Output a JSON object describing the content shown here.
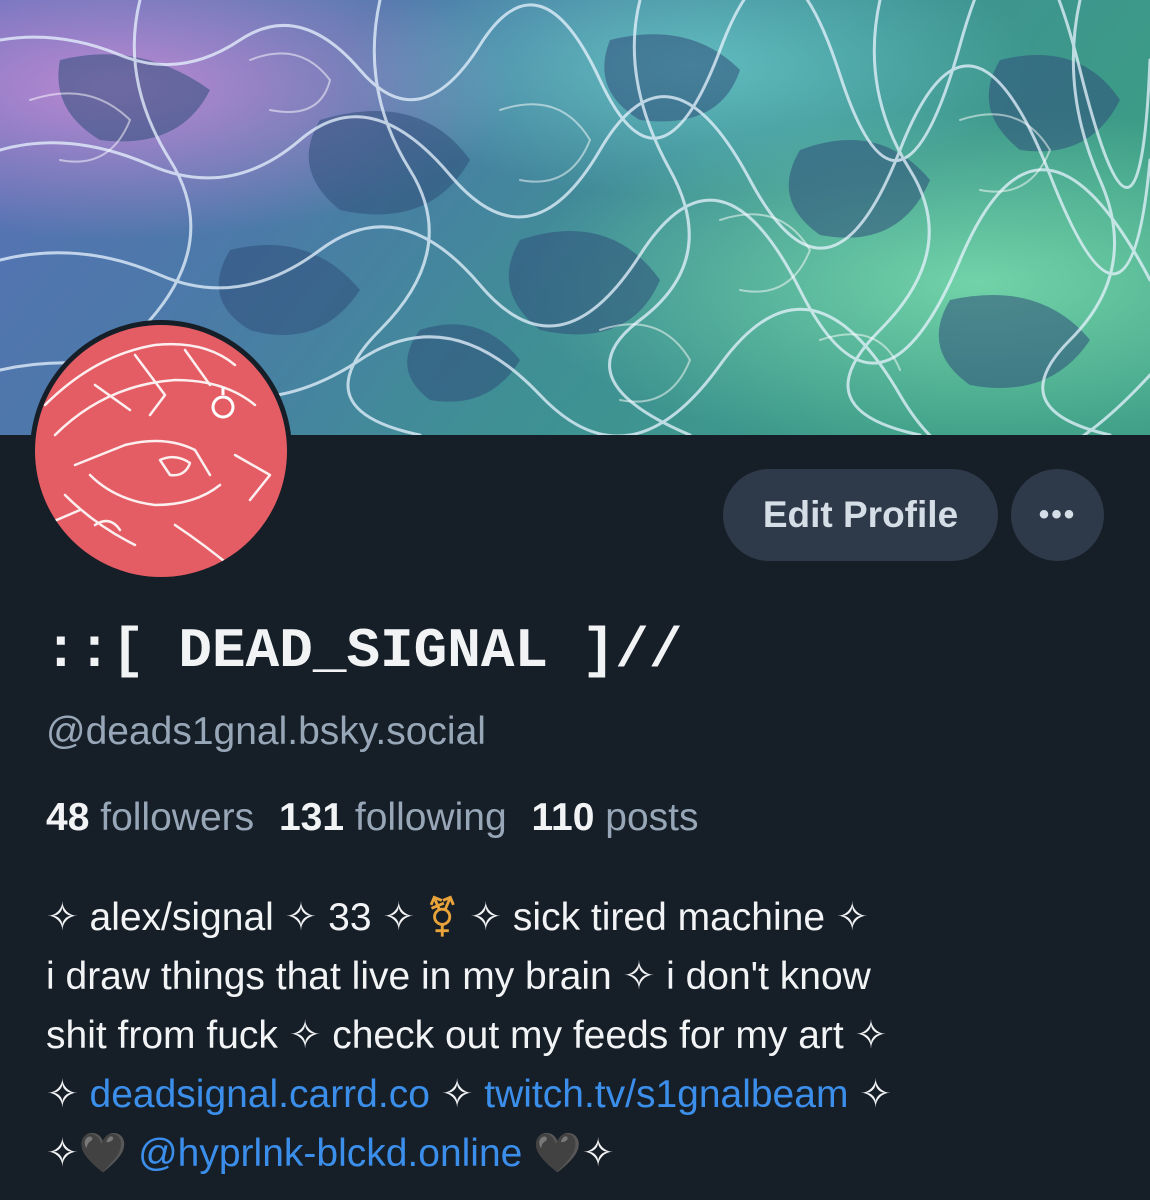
{
  "colors": {
    "background": "#161e27",
    "button_bg": "#2e3a49",
    "link": "#3b8eea",
    "avatar_bg": "#e55d64",
    "muted_text": "#98a7b8"
  },
  "banner": {
    "icon": "water-caustics-banner"
  },
  "avatar": {
    "icon": "red-sketch-avatar"
  },
  "actions": {
    "edit_profile_label": "Edit Profile",
    "more_label": "•••"
  },
  "profile": {
    "display_name": "::[ DEAD_SIGNAL ]//",
    "handle": "@deads1gnal.bsky.social"
  },
  "stats": {
    "followers_count": "48",
    "followers_label": "followers",
    "following_count": "131",
    "following_label": "following",
    "posts_count": "110",
    "posts_label": "posts"
  },
  "bio": {
    "line1_a": "✧ alex/signal ✧ 33 ✧ ",
    "line1_emoji": "⚧",
    "line1_b": " ✧ sick tired machine ✧",
    "line2": "i draw things that live in my brain ✧ i don't know",
    "line3": "shit from fuck ✧ check out my feeds for my art ✧",
    "line4_a": "✧ ",
    "link_carrd": "deadsignal.carrd.co",
    "line4_b": " ✧ ",
    "link_twitch": "twitch.tv/s1gnalbeam",
    "line4_c": " ✧",
    "line5_a": "✧🖤 ",
    "link_mention": "@hyprlnk-blckd.online",
    "line5_b": " 🖤✧"
  }
}
